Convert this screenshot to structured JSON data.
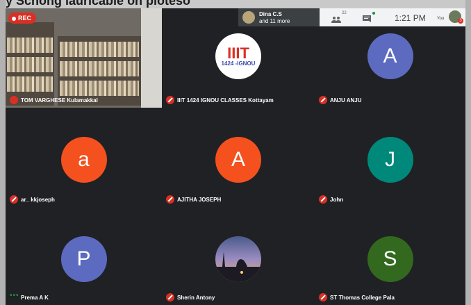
{
  "background": {
    "caption": "ay Schong lauricable on pioteso"
  },
  "recording": {
    "label": "REC"
  },
  "presenter": {
    "name": "Dina C.S",
    "more": "and 11 more"
  },
  "topbar": {
    "people_count": "22",
    "time": "1:21 PM",
    "you_label": "You",
    "notification_count": "3"
  },
  "tiles": [
    {
      "name": "TOM VARGHESE Kulamakkal",
      "type": "video"
    },
    {
      "name": "IIIT 1424 IGNOU CLASSES Kottayam",
      "type": "logo",
      "logo_top": "IIIT",
      "logo_bottom": "1424 -IGNOU",
      "color": "#ffffff"
    },
    {
      "name": "ANJU ANJU",
      "type": "avatar",
      "letter": "A",
      "color": "#5c6bc0"
    },
    {
      "name": "ar_ kkjoseph",
      "type": "avatar",
      "letter": "a",
      "color": "#f4511e"
    },
    {
      "name": "AJITHA JOSEPH",
      "type": "avatar",
      "letter": "A",
      "color": "#f4511e"
    },
    {
      "name": "John",
      "type": "avatar",
      "letter": "J",
      "color": "#00897b"
    },
    {
      "name": "Prema A K",
      "type": "avatar",
      "letter": "P",
      "color": "#5c6bc0",
      "speaking": true
    },
    {
      "name": "Sherin Antony",
      "type": "photo"
    },
    {
      "name": "ST Thomas College Pala",
      "type": "avatar",
      "letter": "S",
      "color": "#33691e"
    }
  ]
}
